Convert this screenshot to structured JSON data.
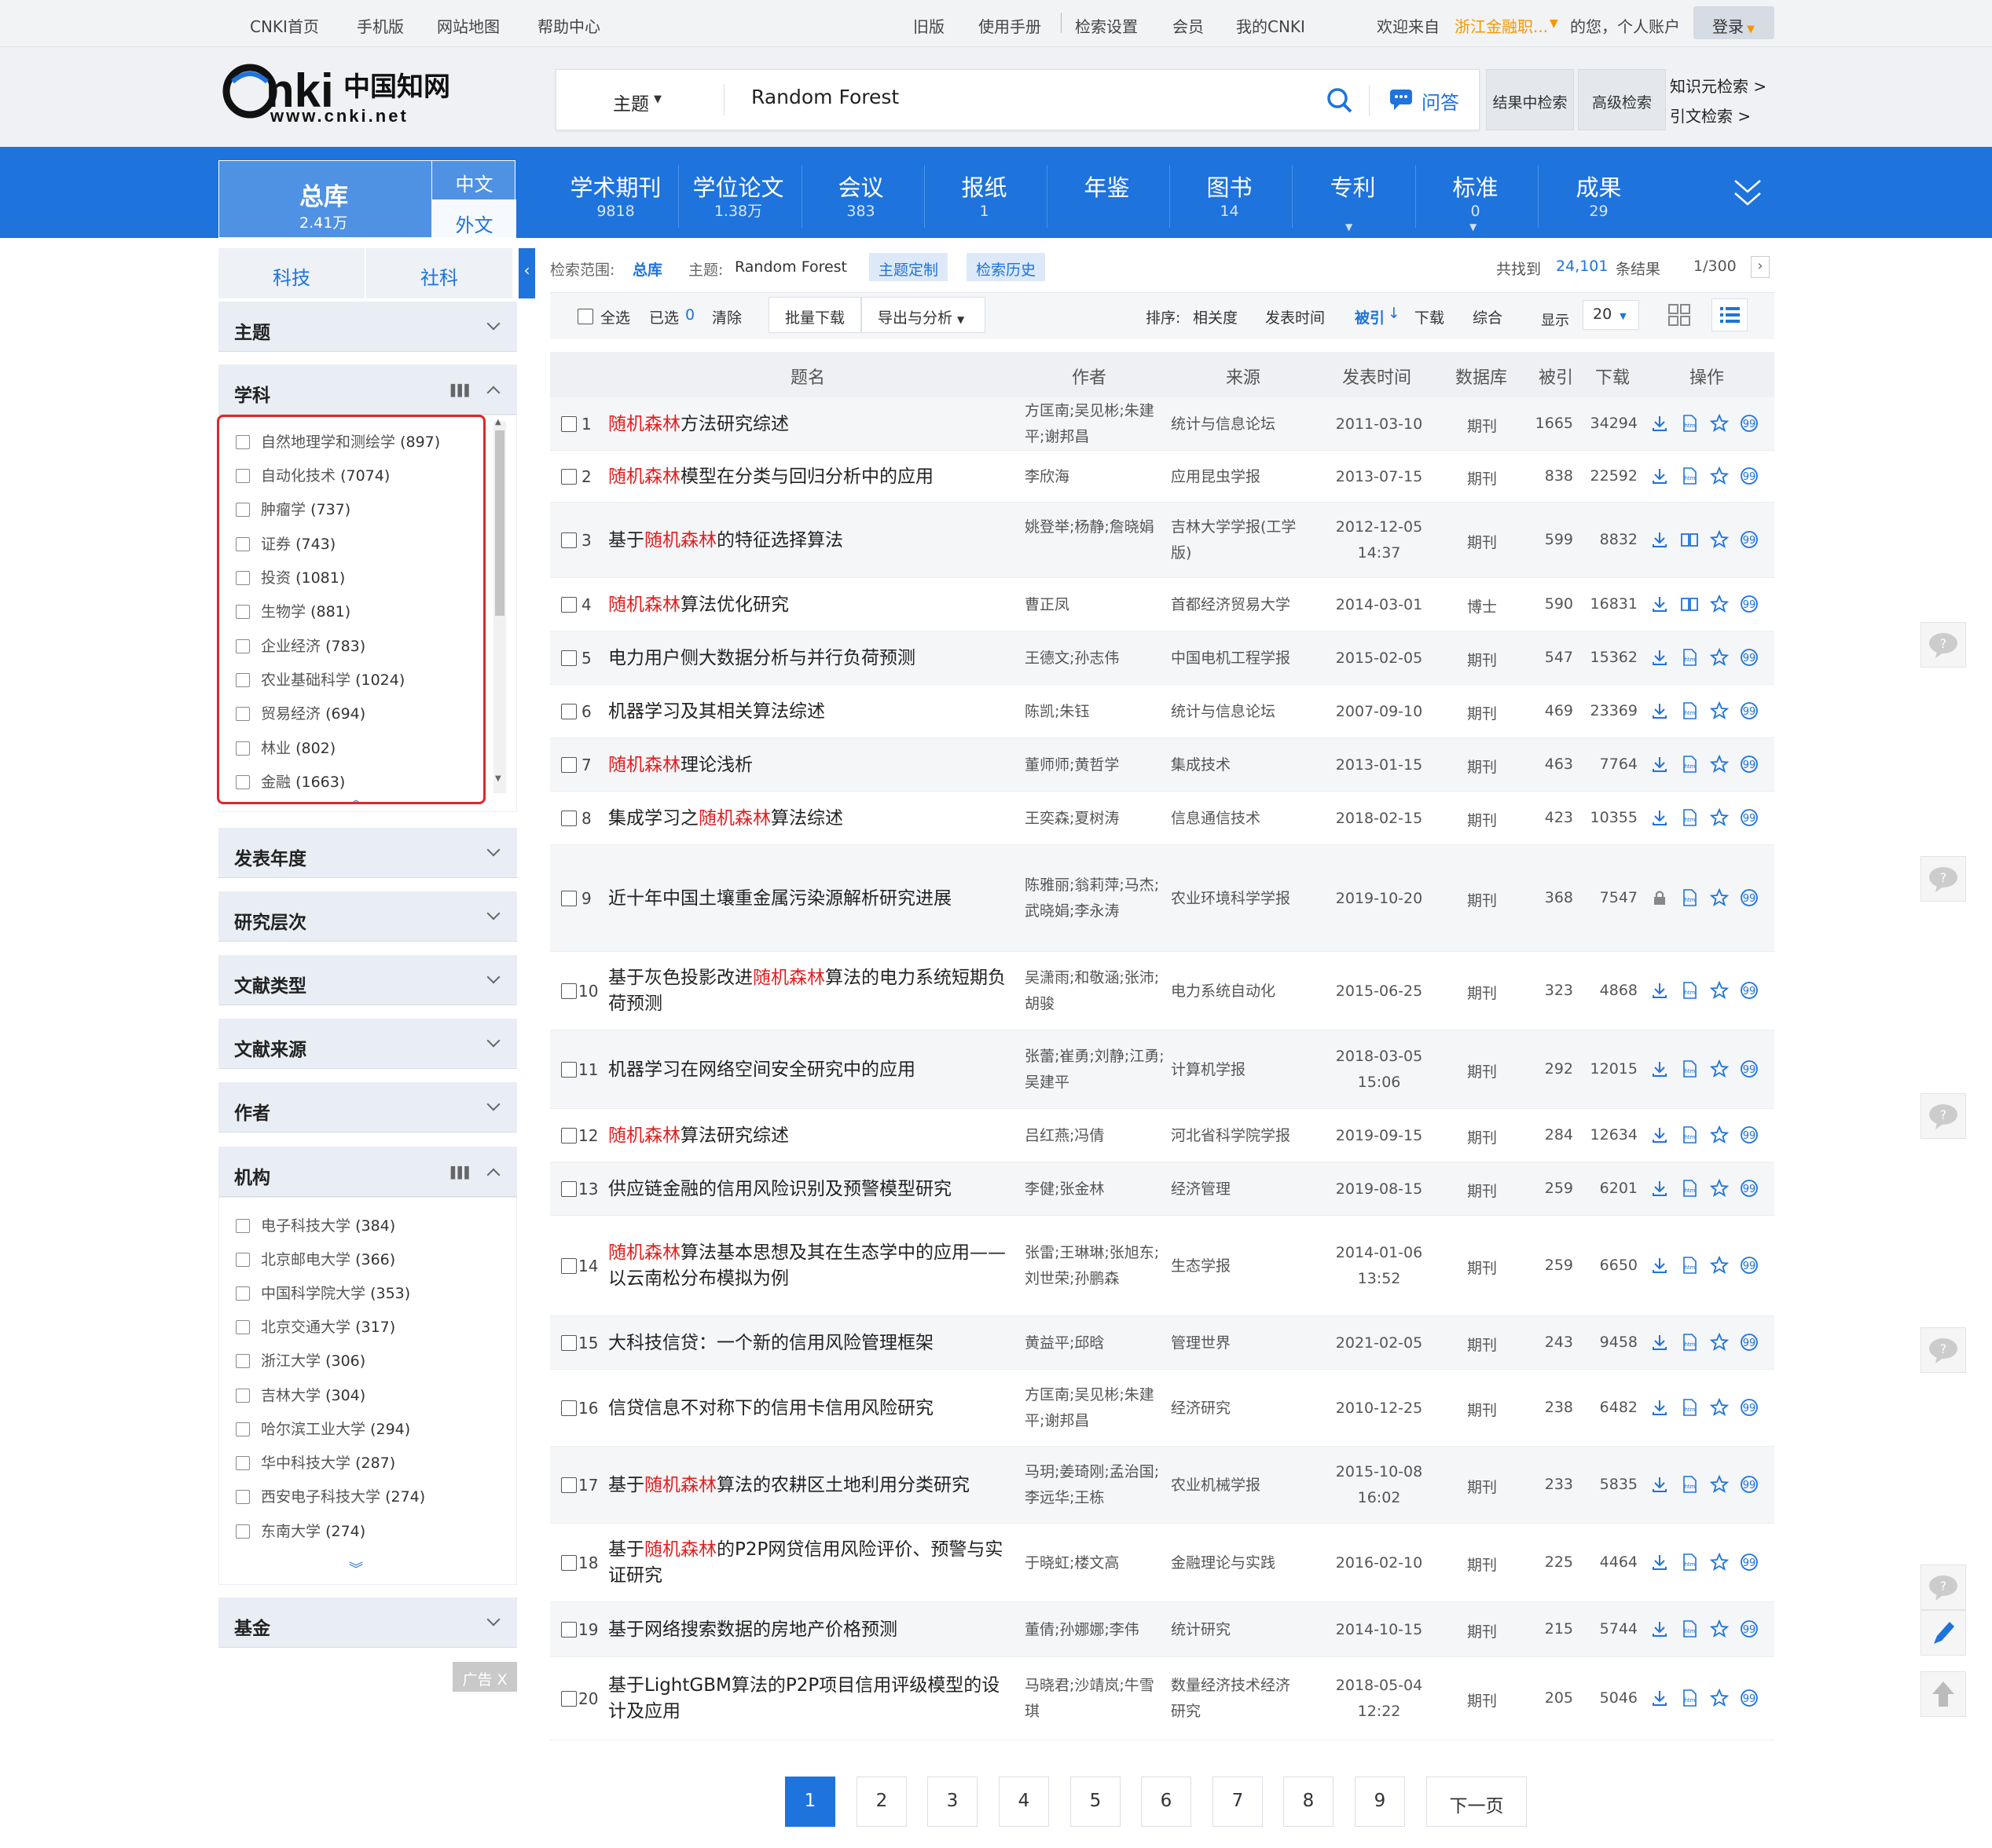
{
  "topbar": {
    "links": [
      "CNKI首页",
      "手机版",
      "网站地图",
      "帮助中心"
    ],
    "right_links": [
      "旧版",
      "使用手册",
      "检索设置",
      "会员",
      "我的CNKI"
    ],
    "welcome": "欢迎来自",
    "org": "浙江金融职...",
    "org_suffix": "的您，个人账户",
    "login": "登录"
  },
  "logo": {
    "text": "cnki",
    "cn": "中国知网",
    "url": "www.cnki.net"
  },
  "search": {
    "field": "主题",
    "query": "Random Forest",
    "qa": "问答",
    "result_search": "结果中检索",
    "advanced": "高级检索",
    "knowledge": "知识元检索 >",
    "citation": "引文检索 >"
  },
  "nav": {
    "total_label": "总库",
    "total_count": "2.41万",
    "zh": "中文",
    "foreign": "外文",
    "items": [
      {
        "label": "学术期刊",
        "count": "9818"
      },
      {
        "label": "学位论文",
        "count": "1.38万"
      },
      {
        "label": "会议",
        "count": "383"
      },
      {
        "label": "报纸",
        "count": "1"
      },
      {
        "label": "年鉴",
        "count": ""
      },
      {
        "label": "图书",
        "count": "14"
      },
      {
        "label": "专利",
        "count": ""
      },
      {
        "label": "标准",
        "count": "0"
      },
      {
        "label": "成果",
        "count": "29"
      }
    ]
  },
  "sidebar": {
    "tabs": [
      "科技",
      "社科"
    ],
    "panels": {
      "theme": "主题",
      "subject": "学科",
      "year": "发表年度",
      "level": "研究层次",
      "doctype": "文献类型",
      "source": "文献来源",
      "author": "作者",
      "org": "机构",
      "fund": "基金"
    },
    "subject_items": [
      {
        "name": "自然地理学和测绘学",
        "count": "(897)"
      },
      {
        "name": "自动化技术",
        "count": "(7074)"
      },
      {
        "name": "肿瘤学",
        "count": "(737)"
      },
      {
        "name": "证券",
        "count": "(743)"
      },
      {
        "name": "投资",
        "count": "(1081)"
      },
      {
        "name": "生物学",
        "count": "(881)"
      },
      {
        "name": "企业经济",
        "count": "(783)"
      },
      {
        "name": "农业基础科学",
        "count": "(1024)"
      },
      {
        "name": "贸易经济",
        "count": "(694)"
      },
      {
        "name": "林业",
        "count": "(802)"
      },
      {
        "name": "金融",
        "count": "(1663)"
      }
    ],
    "org_items": [
      {
        "name": "电子科技大学",
        "count": "(384)"
      },
      {
        "name": "北京邮电大学",
        "count": "(366)"
      },
      {
        "name": "中国科学院大学",
        "count": "(353)"
      },
      {
        "name": "北京交通大学",
        "count": "(317)"
      },
      {
        "name": "浙江大学",
        "count": "(306)"
      },
      {
        "name": "吉林大学",
        "count": "(304)"
      },
      {
        "name": "哈尔滨工业大学",
        "count": "(294)"
      },
      {
        "name": "华中科技大学",
        "count": "(287)"
      },
      {
        "name": "西安电子科技大学",
        "count": "(274)"
      },
      {
        "name": "东南大学",
        "count": "(274)"
      }
    ],
    "ad": "广告 X"
  },
  "scope": {
    "label": "检索范围:",
    "value": "总库",
    "theme_label": "主题:",
    "theme_value": "Random Forest",
    "custom": "主题定制",
    "history": "检索历史",
    "found_prefix": "共找到",
    "found": "24,101",
    "found_suffix": "条结果",
    "page": "1/300"
  },
  "toolbar": {
    "select_all": "全选",
    "selected": "已选",
    "selected_count": "0",
    "clear": "清除",
    "batch": "批量下载",
    "export": "导出与分析",
    "sort_label": "排序:",
    "sorts": [
      "相关度",
      "发表时间",
      "被引",
      "下载",
      "综合"
    ],
    "show": "显示",
    "pagesize": "20"
  },
  "columns": [
    "题名",
    "作者",
    "来源",
    "发表时间",
    "数据库",
    "被引",
    "下载",
    "操作"
  ],
  "rows": [
    {
      "n": "1",
      "pre": "",
      "hl": "随机森林",
      "post": "方法研究综述",
      "authors": "方匡南;吴见彬;朱建平;谢邦昌",
      "source": "统计与信息论坛",
      "date": "2011-03-10",
      "db": "期刊",
      "cite": "1665",
      "dl": "34294"
    },
    {
      "n": "2",
      "pre": "",
      "hl": "随机森林",
      "post": "模型在分类与回归分析中的应用",
      "authors": "李欣海",
      "source": "应用昆虫学报",
      "date": "2013-07-15",
      "db": "期刊",
      "cite": "838",
      "dl": "22592"
    },
    {
      "n": "3",
      "pre": "基于",
      "hl": "随机森林",
      "post": "的特征选择算法",
      "authors": "姚登举;杨静;詹晓娟",
      "source": "吉林大学学报(工学版)",
      "date": "2012-12-05 14:37",
      "db": "期刊",
      "cite": "599",
      "dl": "8832"
    },
    {
      "n": "4",
      "pre": "",
      "hl": "随机森林",
      "post": "算法优化研究",
      "authors": "曹正凤",
      "source": "首都经济贸易大学",
      "date": "2014-03-01",
      "db": "博士",
      "cite": "590",
      "dl": "16831"
    },
    {
      "n": "5",
      "pre": "电力用户侧大数据分析与并行负荷预测",
      "hl": "",
      "post": "",
      "authors": "王德文;孙志伟",
      "source": "中国电机工程学报",
      "date": "2015-02-05",
      "db": "期刊",
      "cite": "547",
      "dl": "15362"
    },
    {
      "n": "6",
      "pre": "机器学习及其相关算法综述",
      "hl": "",
      "post": "",
      "authors": "陈凯;朱钰",
      "source": "统计与信息论坛",
      "date": "2007-09-10",
      "db": "期刊",
      "cite": "469",
      "dl": "23369"
    },
    {
      "n": "7",
      "pre": "",
      "hl": "随机森林",
      "post": "理论浅析",
      "authors": "董师师;黄哲学",
      "source": "集成技术",
      "date": "2013-01-15",
      "db": "期刊",
      "cite": "463",
      "dl": "7764"
    },
    {
      "n": "8",
      "pre": "集成学习之",
      "hl": "随机森林",
      "post": "算法综述",
      "authors": "王奕森;夏树涛",
      "source": "信息通信技术",
      "date": "2018-02-15",
      "db": "期刊",
      "cite": "423",
      "dl": "10355"
    },
    {
      "n": "9",
      "pre": "近十年中国土壤重金属污染源解析研究进展",
      "hl": "",
      "post": "",
      "authors": "陈雅丽;翁莉萍;马杰;武晓娟;李永涛",
      "source": "农业环境科学学报",
      "date": "2019-10-20",
      "db": "期刊",
      "cite": "368",
      "dl": "7547"
    },
    {
      "n": "10",
      "pre": "基于灰色投影改进",
      "hl": "随机森林",
      "post": "算法的电力系统短期负荷预测",
      "authors": "吴潇雨;和敬涵;张沛;胡骏",
      "source": "电力系统自动化",
      "date": "2015-06-25",
      "db": "期刊",
      "cite": "323",
      "dl": "4868"
    },
    {
      "n": "11",
      "pre": "机器学习在网络空间安全研究中的应用",
      "hl": "",
      "post": "",
      "authors": "张蕾;崔勇;刘静;江勇;吴建平",
      "source": "计算机学报",
      "date": "2018-03-05 15:06",
      "db": "期刊",
      "cite": "292",
      "dl": "12015"
    },
    {
      "n": "12",
      "pre": "",
      "hl": "随机森林",
      "post": "算法研究综述",
      "authors": "吕红燕;冯倩",
      "source": "河北省科学院学报",
      "date": "2019-09-15",
      "db": "期刊",
      "cite": "284",
      "dl": "12634"
    },
    {
      "n": "13",
      "pre": "供应链金融的信用风险识别及预警模型研究",
      "hl": "",
      "post": "",
      "authors": "李健;张金林",
      "source": "经济管理",
      "date": "2019-08-15",
      "db": "期刊",
      "cite": "259",
      "dl": "6201"
    },
    {
      "n": "14",
      "pre": "",
      "hl": "随机森林",
      "post": "算法基本思想及其在生态学中的应用——以云南松分布模拟为例",
      "authors": "张雷;王琳琳;张旭东;刘世荣;孙鹏森",
      "source": "生态学报",
      "date": "2014-01-06 13:52",
      "db": "期刊",
      "cite": "259",
      "dl": "6650"
    },
    {
      "n": "15",
      "pre": "大科技信贷：一个新的信用风险管理框架",
      "hl": "",
      "post": "",
      "authors": "黄益平;邱晗",
      "source": "管理世界",
      "date": "2021-02-05",
      "db": "期刊",
      "cite": "243",
      "dl": "9458"
    },
    {
      "n": "16",
      "pre": "信贷信息不对称下的信用卡信用风险研究",
      "hl": "",
      "post": "",
      "authors": "方匡南;吴见彬;朱建平;谢邦昌",
      "source": "经济研究",
      "date": "2010-12-25",
      "db": "期刊",
      "cite": "238",
      "dl": "6482"
    },
    {
      "n": "17",
      "pre": "基于",
      "hl": "随机森林",
      "post": "算法的农耕区土地利用分类研究",
      "authors": "马玥;姜琦刚;孟治国;李远华;王栋",
      "source": "农业机械学报",
      "date": "2015-10-08 16:02",
      "db": "期刊",
      "cite": "233",
      "dl": "5835"
    },
    {
      "n": "18",
      "pre": "基于",
      "hl": "随机森林",
      "post": "的P2P网贷信用风险评价、预警与实证研究",
      "authors": "于晓虹;楼文高",
      "source": "金融理论与实践",
      "date": "2016-02-10",
      "db": "期刊",
      "cite": "225",
      "dl": "4464"
    },
    {
      "n": "19",
      "pre": "基于网络搜索数据的房地产价格预测",
      "hl": "",
      "post": "",
      "authors": "董倩;孙娜娜;李伟",
      "source": "统计研究",
      "date": "2014-10-15",
      "db": "期刊",
      "cite": "215",
      "dl": "5744"
    },
    {
      "n": "20",
      "pre": "基于LightGBM算法的P2P项目信用评级模型的设计及应用",
      "hl": "",
      "post": "",
      "authors": "马晓君;沙靖岚;牛雪琪",
      "source": "数量经济技术经济研究",
      "date": "2018-05-04 12:22",
      "db": "期刊",
      "cite": "205",
      "dl": "5046"
    }
  ],
  "pagination": {
    "pages": [
      "1",
      "2",
      "3",
      "4",
      "5",
      "6",
      "7",
      "8",
      "9"
    ],
    "next": "下一页"
  },
  "colors": {
    "brand": "#1e73dc",
    "highlight": "#e11f1f",
    "selection_box": "#e0262b"
  }
}
